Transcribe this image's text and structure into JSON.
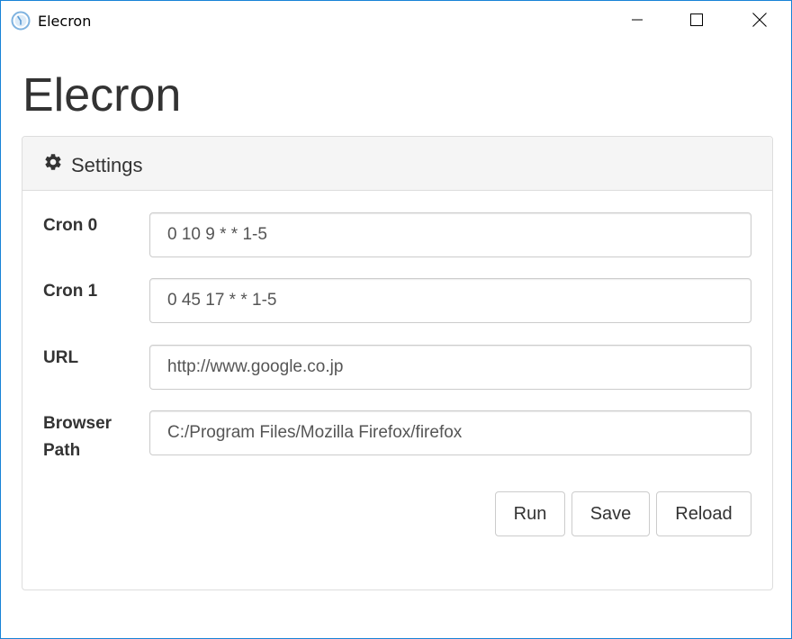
{
  "window": {
    "title": "Elecron",
    "accent_color": "#1883d7",
    "controls": [
      "minimize-icon",
      "maximize-icon",
      "close-icon"
    ]
  },
  "app": {
    "heading": "Elecron"
  },
  "panel": {
    "icon": "gear-icon",
    "title": "Settings"
  },
  "form": {
    "cron0": {
      "label": "Cron 0",
      "value": "0 10 9 * * 1-5"
    },
    "cron1": {
      "label": "Cron 1",
      "value": "0 45 17 * * 1-5"
    },
    "url": {
      "label": "URL",
      "value": "http://www.google.co.jp"
    },
    "browser_path": {
      "label": "Browser Path",
      "value": "C:/Program Files/Mozilla Firefox/firefox"
    }
  },
  "actions": {
    "run_label": "Run",
    "save_label": "Save",
    "reload_label": "Reload"
  }
}
